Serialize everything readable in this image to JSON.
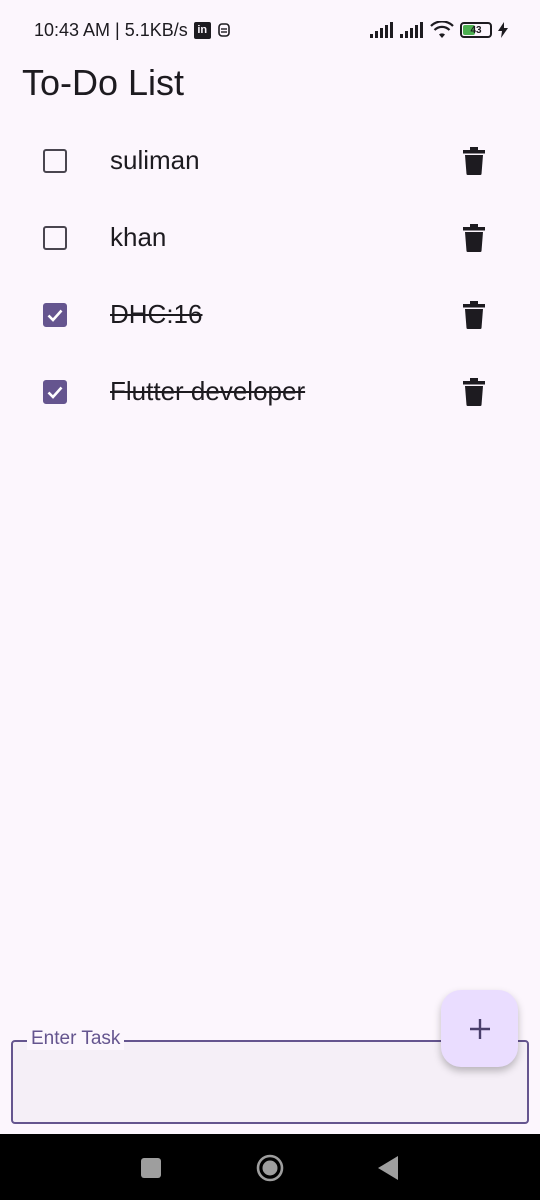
{
  "status_bar": {
    "time_speed": "10:43 AM | 5.1KB/s",
    "linkedin_label": "in",
    "battery_level": "43"
  },
  "title": "To-Do List",
  "tasks": [
    {
      "text": "suliman",
      "done": false
    },
    {
      "text": "khan",
      "done": false
    },
    {
      "text": "DHC:16",
      "done": true
    },
    {
      "text": "Flutter developer",
      "done": true
    }
  ],
  "input": {
    "label": "Enter Task",
    "value": ""
  },
  "fab": {
    "icon": "plus-icon"
  },
  "colors": {
    "accent": "#65558f",
    "background": "#fcf6fd",
    "fab": "#eaddff"
  }
}
